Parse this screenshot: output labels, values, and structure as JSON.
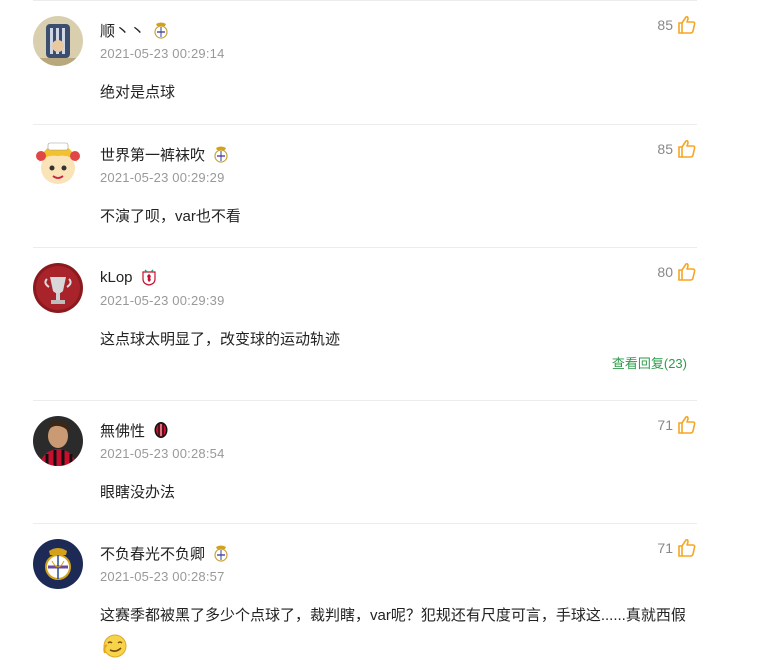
{
  "comments": [
    {
      "username": "顺丶丶",
      "badge_icon": "real-madrid-badge-icon",
      "time": "2021-05-23 00:29:14",
      "text": "绝对是点球",
      "likes": "85"
    },
    {
      "username": "世界第一裤袜吹",
      "badge_icon": "real-madrid-badge-icon",
      "time": "2021-05-23 00:29:29",
      "text": "不演了呗，var也不看",
      "likes": "85"
    },
    {
      "username": "kLop",
      "badge_icon": "liverpool-badge-icon",
      "time": "2021-05-23 00:29:39",
      "text": "这点球太明显了，改变球的运动轨迹",
      "likes": "80",
      "replies": "查看回复(23)"
    },
    {
      "username": "無佛性",
      "badge_icon": "ac-milan-badge-icon",
      "time": "2021-05-23 00:28:54",
      "text": "眼瞎没办法",
      "likes": "71"
    },
    {
      "username": "不负春光不负卿",
      "badge_icon": "real-madrid-badge-icon",
      "time": "2021-05-23 00:28:57",
      "text": "这赛季都被黑了多少个点球了，裁判瞎，var呢？犯规还有尺度可言，手球这......真就西假",
      "likes": "71"
    }
  ],
  "colors": {
    "like_icon": "#f5a623",
    "replies_link": "#2e9a4a",
    "meta_text": "#999999"
  }
}
